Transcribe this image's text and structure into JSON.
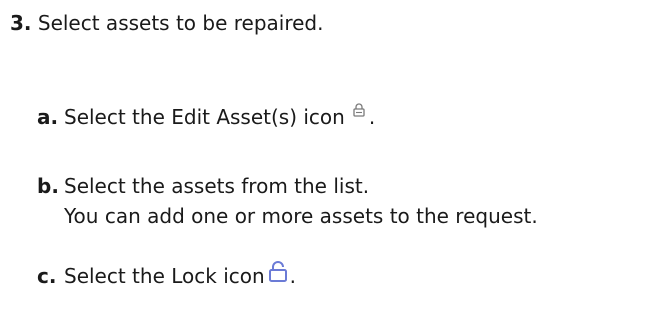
{
  "step": {
    "number": "3.",
    "text": "Select assets to be repaired."
  },
  "substeps": [
    {
      "letter": "a.",
      "text_before_icon": "Select the Edit Asset(s) icon",
      "icon": "edit-assets-lock-icon",
      "text_after_icon": "."
    },
    {
      "letter": "b.",
      "line1": "Select the assets from the list.",
      "line2": "You can add one or more assets to the request."
    },
    {
      "letter": "c.",
      "text_before_icon": "Select the Lock icon",
      "icon": "lock-icon",
      "text_after_icon": "."
    }
  ],
  "colors": {
    "text": "#1a1a1a",
    "edit_icon": "#7a7a7a",
    "lock_icon": "#6b7bd6"
  }
}
